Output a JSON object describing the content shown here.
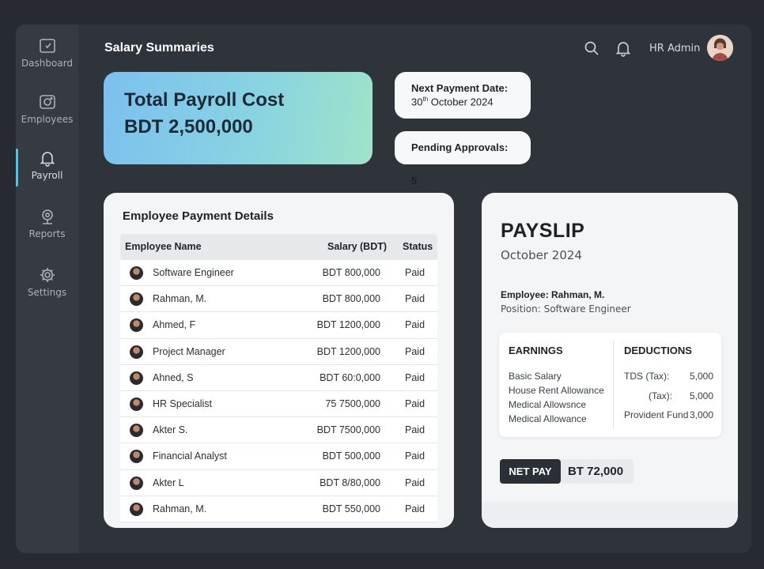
{
  "sidebar": {
    "items": [
      {
        "label": "Dashboard",
        "icon": "dashboard-icon"
      },
      {
        "label": "Employees",
        "icon": "camera-icon"
      },
      {
        "label": "Payroll",
        "icon": "bell-icon"
      },
      {
        "label": "Reports",
        "icon": "webcam-icon"
      },
      {
        "label": "Settings",
        "icon": "gear-icon"
      }
    ],
    "active": "Payroll"
  },
  "header": {
    "title": "Salary Summaries",
    "user": "HR Admin"
  },
  "kpi": {
    "label": "Total Payroll Cost",
    "value": "BDT 2,500,000"
  },
  "next_payment": {
    "label": "Next Payment Date:",
    "day": "30",
    "suffix": "th",
    "month_year": " October 2024"
  },
  "pending": {
    "label": "Pending Approvals: 5"
  },
  "employee_table": {
    "title": "Employee Payment Details",
    "columns": [
      "Employee Name",
      "Salary (BDT)",
      "Status"
    ],
    "rows": [
      {
        "name": "Software Engineer",
        "salary": "BDT 800,000",
        "status": "Paid"
      },
      {
        "name": "Rahman, M.",
        "salary": "BDT 800,000",
        "status": "Paid"
      },
      {
        "name": "Ahmed, F",
        "salary": "BDT 1200,000",
        "status": "Paid"
      },
      {
        "name": "Project Manager",
        "salary": "BDT 1200,000",
        "status": "Paid"
      },
      {
        "name": "Ahned, S",
        "salary": "BDT 60:0,000",
        "status": "Paid"
      },
      {
        "name": "HR Specialist",
        "salary": "75 7500,000",
        "status": "Paid"
      },
      {
        "name": "Akter S.",
        "salary": "BDT 7500,000",
        "status": "Paid"
      },
      {
        "name": "Financial Analyst",
        "salary": "BDT 500,000",
        "status": "Paid"
      },
      {
        "name": "Akter L",
        "salary": "BDT 8/80,000",
        "status": "Paid"
      },
      {
        "name": "Rahman, M.",
        "salary": "BDT 550,000",
        "status": "Paid"
      }
    ]
  },
  "payslip": {
    "title": "PAYSLIP",
    "month": "October 2024",
    "employee": "Employee: Rahman, M.",
    "position": "Position: Software Engineer",
    "earnings_title": "EARNINGS",
    "earnings": [
      "Basic Salary",
      "House Rent Allowance",
      "Medical Allowsnce",
      "Medical Allowance"
    ],
    "deductions_title": "DEDUCTIONS",
    "deductions": [
      {
        "label": "TDS (Tax):",
        "value": "5,000"
      },
      {
        "label": "(Tax):",
        "value": "5,000"
      },
      {
        "label": "Provident Fund",
        "value": "3,000"
      }
    ],
    "net_label": "NET PAY",
    "net_value": "BT 72,000"
  },
  "colors": {
    "accent": "#4fc3e8",
    "background": "#272b31",
    "sidebar": "#363b42"
  }
}
